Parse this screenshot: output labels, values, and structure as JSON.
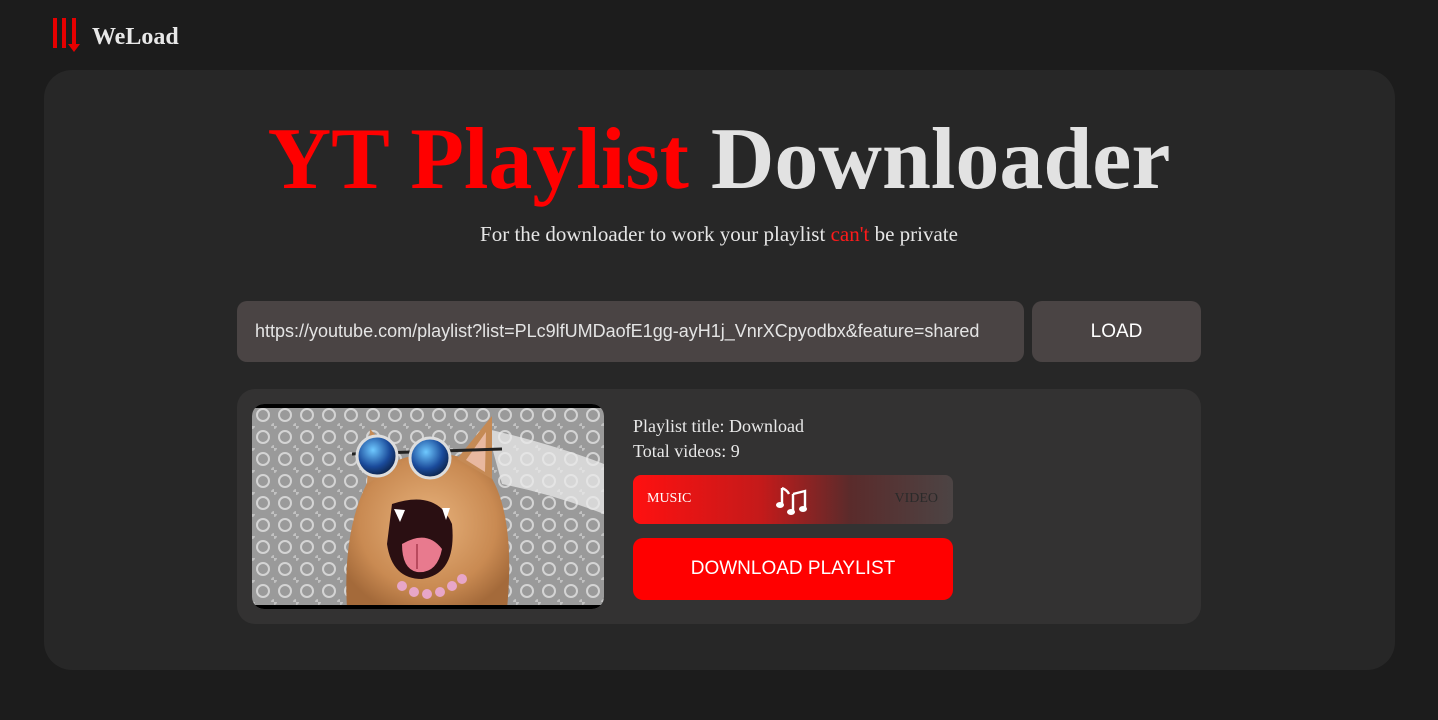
{
  "brand": {
    "name": "WeLoad",
    "logo_icon": "weload-logo-icon",
    "accent_color": "#ff0000"
  },
  "hero": {
    "title_accent": "YT Playlist",
    "title_rest": "Downloader",
    "subtitle_before": "For the downloader to work your playlist ",
    "subtitle_warn": "can't",
    "subtitle_after": " be private"
  },
  "url_form": {
    "value": "https://youtube.com/playlist?list=PLc9lfUMDaofE1gg-ayH1j_VnrXCpyodbx&feature=shared",
    "load_label": "LOAD"
  },
  "playlist": {
    "thumbnail": "cat-with-sunglasses-thumbnail",
    "title_line": "Playlist title: Download",
    "count_line": "Total videos: 9",
    "mode_toggle": {
      "left_label": "MUSIC",
      "right_label": "VIDEO",
      "icon": "music-notes-icon",
      "selected": "MUSIC"
    },
    "download_label": "DOWNLOAD PLAYLIST"
  }
}
